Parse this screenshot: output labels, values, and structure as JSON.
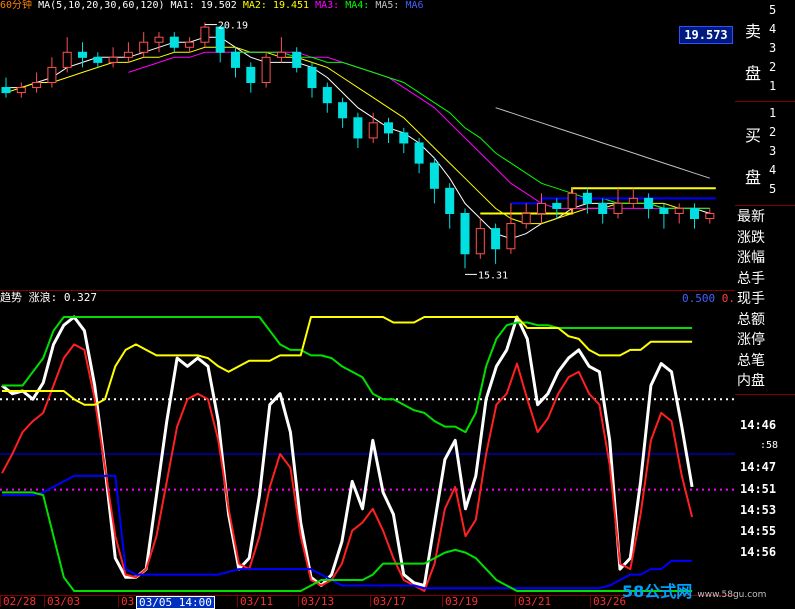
{
  "header": {
    "period": "60分钟",
    "ma_label": "MA(5,10,20,30,60,120)",
    "ma1": "MA1:",
    "ma1_val": "19.502",
    "ma2": "MA2:",
    "ma2_val": "19.451",
    "ma3": "MA3:",
    "ma4": "MA4:",
    "ma5": "MA5:",
    "ma6": "MA6"
  },
  "price_box": "19.573",
  "high_label": "20.19",
  "low_label": "15.31",
  "indicator": {
    "name": "趋势",
    "label": "涨浪: 0.327",
    "right_label": "0.500",
    "right_label2": "0."
  },
  "sidebar": {
    "sell_group_label": "卖盘",
    "sell_levels": [
      "5",
      "4",
      "3",
      "2",
      "1"
    ],
    "buy_group_label": "买盘",
    "buy_levels": [
      "1",
      "2",
      "3",
      "4",
      "5"
    ],
    "fields": [
      "最新",
      "涨跌",
      "涨幅",
      "总手",
      "现手",
      "总额",
      "涨停",
      "总笔",
      "内盘"
    ],
    "times": [
      "14:46",
      ":58",
      "14:47",
      "14:51",
      "14:53",
      "14:55",
      "14:56"
    ]
  },
  "date_axis": [
    "02/28",
    "03/03",
    "03",
    "03/05 14:00",
    "03/11",
    "03/13",
    "03/17",
    "03/19",
    "03/21",
    "03/26"
  ],
  "watermark": {
    "brand": "58公式网",
    "url": "www.58gu.com"
  },
  "colors": {
    "up": "#ff5050",
    "down": "#00e0e0",
    "ma1": "#ffffff",
    "ma2": "#ffff00",
    "ma3": "#ff00ff",
    "ma4": "#00ff00",
    "ma5": "#c0c0c0",
    "ma6": "#0000ff"
  },
  "chart_data": [
    {
      "type": "candlestick",
      "title": "",
      "ylim": [
        15.0,
        20.4
      ],
      "annotations": [
        {
          "text": "20.19",
          "kind": "high"
        },
        {
          "text": "15.31",
          "kind": "low"
        }
      ],
      "candles": [
        [
          18.9,
          18.8,
          19.1,
          18.7
        ],
        [
          18.8,
          18.9,
          19.0,
          18.7
        ],
        [
          18.9,
          19.0,
          19.2,
          18.8
        ],
        [
          19.0,
          19.3,
          19.5,
          18.9
        ],
        [
          19.3,
          19.6,
          19.9,
          19.2
        ],
        [
          19.6,
          19.5,
          19.8,
          19.3
        ],
        [
          19.5,
          19.4,
          19.6,
          19.3
        ],
        [
          19.4,
          19.5,
          19.7,
          19.3
        ],
        [
          19.5,
          19.6,
          19.8,
          19.4
        ],
        [
          19.6,
          19.8,
          20.0,
          19.5
        ],
        [
          19.8,
          19.9,
          20.0,
          19.6
        ],
        [
          19.9,
          19.7,
          20.0,
          19.6
        ],
        [
          19.7,
          19.8,
          19.9,
          19.6
        ],
        [
          19.8,
          20.1,
          20.19,
          19.7
        ],
        [
          20.1,
          19.6,
          20.1,
          19.4
        ],
        [
          19.6,
          19.3,
          19.7,
          19.1
        ],
        [
          19.3,
          19.0,
          19.4,
          18.8
        ],
        [
          19.0,
          19.5,
          19.6,
          18.9
        ],
        [
          19.5,
          19.6,
          19.9,
          19.4
        ],
        [
          19.6,
          19.3,
          19.7,
          19.2
        ],
        [
          19.3,
          18.9,
          19.4,
          18.7
        ],
        [
          18.9,
          18.6,
          19.0,
          18.4
        ],
        [
          18.6,
          18.3,
          18.7,
          18.1
        ],
        [
          18.3,
          17.9,
          18.4,
          17.7
        ],
        [
          17.9,
          18.2,
          18.4,
          17.8
        ],
        [
          18.2,
          18.0,
          18.3,
          17.8
        ],
        [
          18.0,
          17.8,
          18.1,
          17.6
        ],
        [
          17.8,
          17.4,
          17.9,
          17.2
        ],
        [
          17.4,
          16.9,
          17.5,
          16.6
        ],
        [
          16.9,
          16.4,
          17.0,
          16.1
        ],
        [
          16.4,
          15.6,
          16.5,
          15.31
        ],
        [
          15.6,
          16.1,
          16.3,
          15.5
        ],
        [
          16.1,
          15.7,
          16.2,
          15.4
        ],
        [
          15.7,
          16.2,
          16.6,
          15.6
        ],
        [
          16.2,
          16.4,
          16.6,
          16.1
        ],
        [
          16.4,
          16.6,
          16.8,
          16.2
        ],
        [
          16.6,
          16.5,
          16.7,
          16.3
        ],
        [
          16.5,
          16.8,
          16.9,
          16.4
        ],
        [
          16.8,
          16.6,
          16.9,
          16.4
        ],
        [
          16.6,
          16.4,
          16.7,
          16.2
        ],
        [
          16.4,
          16.6,
          16.9,
          16.3
        ],
        [
          16.6,
          16.7,
          16.9,
          16.5
        ],
        [
          16.7,
          16.5,
          16.8,
          16.3
        ],
        [
          16.5,
          16.4,
          16.6,
          16.1
        ],
        [
          16.4,
          16.5,
          16.6,
          16.2
        ],
        [
          16.5,
          16.3,
          16.6,
          16.1
        ],
        [
          16.3,
          16.4,
          16.5,
          16.2
        ]
      ],
      "ma_series": [
        {
          "name": "MA1",
          "values": [
            18.9,
            18.9,
            19.0,
            19.1,
            19.3,
            19.4,
            19.5,
            19.5,
            19.5,
            19.6,
            19.7,
            19.8,
            19.8,
            19.9,
            19.9,
            19.7,
            19.5,
            19.4,
            19.4,
            19.4,
            19.3,
            19.1,
            18.8,
            18.5,
            18.3,
            18.1,
            18.0,
            17.8,
            17.5,
            17.1,
            16.6,
            16.3,
            16.0,
            15.9,
            16.0,
            16.2,
            16.3,
            16.5,
            16.6,
            16.6,
            16.6,
            16.6,
            16.6,
            16.5,
            16.5,
            16.5,
            16.4
          ]
        },
        {
          "name": "MA2",
          "values": [
            18.8,
            18.9,
            19.0,
            19.0,
            19.1,
            19.2,
            19.3,
            19.4,
            19.4,
            19.5,
            19.5,
            19.6,
            19.6,
            19.7,
            19.7,
            19.7,
            19.6,
            19.6,
            19.5,
            19.5,
            19.4,
            19.3,
            19.1,
            18.9,
            18.7,
            18.5,
            18.3,
            18.0,
            17.7,
            17.4,
            17.1,
            16.8,
            16.5,
            16.3,
            16.2,
            16.2,
            16.3,
            16.4,
            16.5,
            16.5,
            16.6,
            16.6,
            16.6,
            16.6,
            16.5,
            16.5,
            16.5
          ]
        },
        {
          "name": "MA3",
          "values": [
            null,
            null,
            null,
            null,
            null,
            null,
            null,
            null,
            19.2,
            19.3,
            19.4,
            19.5,
            19.5,
            19.6,
            19.6,
            19.6,
            19.6,
            19.6,
            19.6,
            19.6,
            19.5,
            19.5,
            19.4,
            19.3,
            19.2,
            19.1,
            18.9,
            18.7,
            18.5,
            18.2,
            17.9,
            17.6,
            17.3,
            17.0,
            16.8,
            16.6,
            16.5,
            16.5,
            16.5,
            16.5,
            16.5,
            16.5,
            16.5,
            16.5,
            16.5,
            16.5,
            16.5
          ]
        },
        {
          "name": "MA4",
          "values": [
            null,
            null,
            null,
            null,
            null,
            null,
            null,
            null,
            null,
            null,
            null,
            null,
            null,
            null,
            null,
            19.6,
            19.6,
            19.6,
            19.6,
            19.5,
            19.5,
            19.4,
            19.4,
            19.3,
            19.2,
            19.1,
            19.0,
            18.8,
            18.6,
            18.4,
            18.1,
            17.9,
            17.6,
            17.4,
            17.2,
            17.0,
            16.9,
            16.8,
            16.7,
            16.7,
            16.6,
            16.6,
            16.6,
            16.5,
            16.5,
            16.5,
            16.5
          ]
        },
        {
          "name": "MA5",
          "values": [
            null,
            null,
            null,
            null,
            null,
            null,
            null,
            null,
            null,
            null,
            null,
            null,
            null,
            null,
            null,
            null,
            null,
            null,
            null,
            null,
            null,
            null,
            null,
            null,
            null,
            null,
            null,
            null,
            null,
            null,
            null,
            null,
            18.5,
            18.4,
            18.3,
            18.2,
            18.1,
            18.0,
            17.9,
            17.8,
            17.7,
            17.6,
            17.5,
            17.4,
            17.3,
            17.2,
            17.1
          ]
        }
      ],
      "support_lines": [
        {
          "color": "#ffff00",
          "start_index": 31,
          "level": 16.4,
          "mid_level": 16.9,
          "switch_index": 37
        },
        {
          "color": "#0000ff",
          "start_index": 33,
          "level": 16.6,
          "mid_level": 16.7,
          "switch_index": 35
        }
      ]
    },
    {
      "type": "line",
      "title": "",
      "ylim": [
        0,
        1
      ],
      "reference_lines": [
        {
          "color": "#ffffff",
          "style": "dotted",
          "y": 0.7
        },
        {
          "color": "#0000ff",
          "style": "solid",
          "y": 0.5
        },
        {
          "color": "#ff00ff",
          "style": "dotted",
          "y": 0.37
        }
      ],
      "series": [
        {
          "name": "white",
          "color": "#ffffff",
          "width": 3,
          "values": [
            0.75,
            0.72,
            0.73,
            0.7,
            0.76,
            0.9,
            0.97,
            1.0,
            0.95,
            0.75,
            0.45,
            0.12,
            0.05,
            0.05,
            0.08,
            0.35,
            0.62,
            0.85,
            0.82,
            0.85,
            0.82,
            0.62,
            0.28,
            0.08,
            0.12,
            0.35,
            0.68,
            0.72,
            0.58,
            0.25,
            0.05,
            0.02,
            0.06,
            0.18,
            0.4,
            0.3,
            0.55,
            0.36,
            0.28,
            0.06,
            0.03,
            0.02,
            0.25,
            0.48,
            0.55,
            0.3,
            0.42,
            0.7,
            0.82,
            0.88,
            1.0,
            0.92,
            0.68,
            0.72,
            0.8,
            0.85,
            0.88,
            0.82,
            0.8,
            0.55,
            0.08,
            0.12,
            0.4,
            0.75,
            0.83,
            0.8,
            0.6,
            0.38
          ]
        },
        {
          "name": "red",
          "color": "#ff2020",
          "width": 2,
          "values": [
            0.43,
            0.5,
            0.58,
            0.62,
            0.65,
            0.75,
            0.85,
            0.9,
            0.88,
            0.7,
            0.45,
            0.2,
            0.06,
            0.05,
            0.08,
            0.2,
            0.4,
            0.6,
            0.7,
            0.72,
            0.7,
            0.55,
            0.3,
            0.1,
            0.08,
            0.2,
            0.38,
            0.5,
            0.45,
            0.2,
            0.04,
            0.02,
            0.04,
            0.1,
            0.22,
            0.25,
            0.3,
            0.22,
            0.12,
            0.04,
            0.02,
            0.0,
            0.1,
            0.3,
            0.38,
            0.2,
            0.26,
            0.5,
            0.68,
            0.72,
            0.83,
            0.7,
            0.58,
            0.63,
            0.72,
            0.78,
            0.8,
            0.72,
            0.68,
            0.46,
            0.1,
            0.08,
            0.28,
            0.55,
            0.65,
            0.62,
            0.42,
            0.27
          ]
        },
        {
          "name": "green",
          "color": "#00e000",
          "width": 2,
          "values": [
            0.75,
            0.75,
            0.75,
            0.8,
            0.85,
            0.95,
            1.0,
            1.0,
            1.0,
            1.0,
            1.0,
            1.0,
            1.0,
            1.0,
            1.0,
            1.0,
            1.0,
            1.0,
            1.0,
            1.0,
            1.0,
            1.0,
            1.0,
            1.0,
            1.0,
            1.0,
            0.95,
            0.9,
            0.88,
            0.88,
            0.86,
            0.86,
            0.85,
            0.82,
            0.8,
            0.78,
            0.72,
            0.7,
            0.7,
            0.68,
            0.66,
            0.65,
            0.62,
            0.6,
            0.6,
            0.58,
            0.65,
            0.82,
            0.92,
            0.97,
            0.98,
            0.98,
            0.97,
            0.97,
            0.96,
            0.96,
            0.96,
            0.96,
            0.96,
            0.96,
            0.96,
            0.96,
            0.96,
            0.96,
            0.96,
            0.96,
            0.96,
            0.96
          ]
        },
        {
          "name": "yellow",
          "color": "#ffff00",
          "width": 2,
          "values": [
            0.73,
            0.73,
            0.73,
            0.73,
            0.73,
            0.73,
            0.73,
            0.7,
            0.68,
            0.68,
            0.7,
            0.82,
            0.88,
            0.9,
            0.88,
            0.86,
            0.86,
            0.86,
            0.86,
            0.86,
            0.85,
            0.82,
            0.8,
            0.82,
            0.84,
            0.84,
            0.84,
            0.86,
            0.86,
            0.86,
            1.0,
            1.0,
            1.0,
            1.0,
            1.0,
            1.0,
            1.0,
            1.0,
            0.98,
            0.98,
            0.98,
            1.0,
            1.0,
            1.0,
            1.0,
            1.0,
            1.0,
            1.0,
            1.0,
            1.0,
            1.0,
            0.96,
            0.96,
            0.96,
            0.96,
            0.93,
            0.92,
            0.88,
            0.86,
            0.86,
            0.86,
            0.88,
            0.88,
            0.91,
            0.91,
            0.91,
            0.91,
            0.91
          ]
        },
        {
          "name": "blue",
          "color": "#0000ff",
          "width": 2,
          "values": [
            0.35,
            0.35,
            0.35,
            0.35,
            0.36,
            0.38,
            0.4,
            0.42,
            0.42,
            0.42,
            0.42,
            0.42,
            0.08,
            0.06,
            0.06,
            0.06,
            0.06,
            0.06,
            0.06,
            0.06,
            0.06,
            0.06,
            0.07,
            0.08,
            0.08,
            0.08,
            0.08,
            0.08,
            0.08,
            0.08,
            0.08,
            0.06,
            0.04,
            0.02,
            0.02,
            0.02,
            0.02,
            0.02,
            0.02,
            0.02,
            0.02,
            0.01,
            0.01,
            0.01,
            0.01,
            0.01,
            0.01,
            0.01,
            0.01,
            0.01,
            0.01,
            0.01,
            0.01,
            0.01,
            0.01,
            0.01,
            0.01,
            0.01,
            0.01,
            0.02,
            0.04,
            0.06,
            0.06,
            0.08,
            0.08,
            0.11,
            0.11,
            0.11
          ]
        },
        {
          "name": "green-low",
          "color": "#00e000",
          "width": 2,
          "values": [
            0.36,
            0.36,
            0.36,
            0.36,
            0.35,
            0.2,
            0.05,
            0.0,
            0.0,
            0.0,
            0.0,
            0.0,
            0.0,
            0.0,
            0.0,
            0.0,
            0.0,
            0.0,
            0.0,
            0.0,
            0.0,
            0.0,
            0.0,
            0.0,
            0.0,
            0.0,
            0.0,
            0.0,
            0.0,
            0.0,
            0.02,
            0.04,
            0.04,
            0.04,
            0.04,
            0.04,
            0.06,
            0.1,
            0.1,
            0.1,
            0.1,
            0.1,
            0.12,
            0.14,
            0.15,
            0.14,
            0.12,
            0.08,
            0.04,
            0.02,
            0.0,
            0.0,
            0.0,
            0.0,
            0.0,
            0.0,
            0.0,
            0.0,
            0.0,
            0.0,
            0.0,
            0.0,
            0.0,
            0.0,
            0.0,
            0.0,
            0.0,
            0.0
          ]
        }
      ]
    }
  ]
}
